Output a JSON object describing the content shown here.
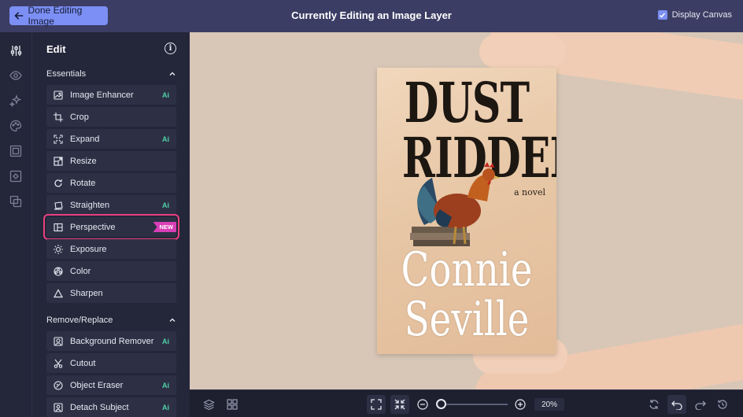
{
  "header": {
    "back_button_label": "Done Editing Image",
    "title": "Currently Editing an Image Layer",
    "display_canvas_label": "Display Canvas",
    "display_canvas_checked": true
  },
  "rail": {
    "icons": [
      "sliders-icon",
      "eye-icon",
      "sparkle-icon",
      "palette-icon",
      "frame-icon",
      "crop-frame-icon",
      "layers-overlap-icon"
    ],
    "active": "sliders-icon"
  },
  "panel": {
    "title": "Edit",
    "sections": [
      {
        "label": "Essentials",
        "tools": [
          {
            "label": "Image Enhancer",
            "ai": "Ai"
          },
          {
            "label": "Crop",
            "ai": ""
          },
          {
            "label": "Expand",
            "ai": "Ai"
          },
          {
            "label": "Resize",
            "ai": ""
          },
          {
            "label": "Rotate",
            "ai": ""
          },
          {
            "label": "Straighten",
            "ai": "Ai"
          },
          {
            "label": "Perspective",
            "badge": "NEW"
          },
          {
            "label": "Exposure",
            "ai": ""
          },
          {
            "label": "Color",
            "ai": ""
          },
          {
            "label": "Sharpen",
            "ai": ""
          }
        ]
      },
      {
        "label": "Remove/Replace",
        "tools": [
          {
            "label": "Background Remover",
            "ai": "Ai"
          },
          {
            "label": "Cutout",
            "ai": ""
          },
          {
            "label": "Object Eraser",
            "ai": "Ai"
          },
          {
            "label": "Detach Subject",
            "ai": "Ai"
          }
        ]
      }
    ]
  },
  "canvas": {
    "book": {
      "title_line1": "DUST",
      "title_line2": "RIDDEN",
      "subtitle": "a novel",
      "author_line1": "Connie",
      "author_line2": "Seville"
    },
    "background_color": "#d8c7b7"
  },
  "footer": {
    "zoom": "20%",
    "zoom_level_fraction": 0.0
  },
  "colors": {
    "accent": "#7b8ff4",
    "highlight": "#e8407e",
    "new_badge": "#d93fb6",
    "ai_badge": "#4fd1a5"
  }
}
